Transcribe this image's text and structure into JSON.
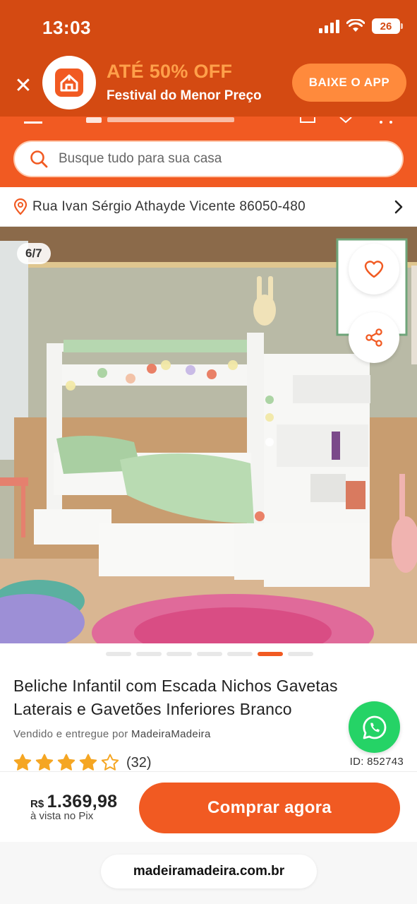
{
  "status_bar": {
    "time": "13:03",
    "battery": "26"
  },
  "promo": {
    "headline": "ATÉ 50% OFF",
    "subline": "Festival do Menor Preço",
    "cta": "BAIXE O APP",
    "close": "✕"
  },
  "search": {
    "placeholder": "Busque tudo para sua casa"
  },
  "address": {
    "text": "Rua Ivan Sérgio Athayde Vicente 86050-480"
  },
  "gallery": {
    "counter": "6/7",
    "current_index": 6,
    "total": 7
  },
  "product": {
    "title": "Beliche Infantil com Escada Nichos Gavetas Laterais e Gavetões Inferiores Branco",
    "seller_prefix": "Vendido e entregue por",
    "seller_name": "MadeiraMadeira",
    "rating": 4,
    "rating_max": 5,
    "review_count": "(32)",
    "id": "ID: 852743"
  },
  "purchase": {
    "currency": "R$",
    "price": "1.369,98",
    "price_note": "à vista no Pix",
    "button": "Comprar agora"
  },
  "browser": {
    "url": "madeiramadeira.com.br"
  },
  "colors": {
    "brand": "#f15a22",
    "promo_bg": "#d44a12",
    "whatsapp": "#25d366",
    "star": "#f5a623"
  }
}
